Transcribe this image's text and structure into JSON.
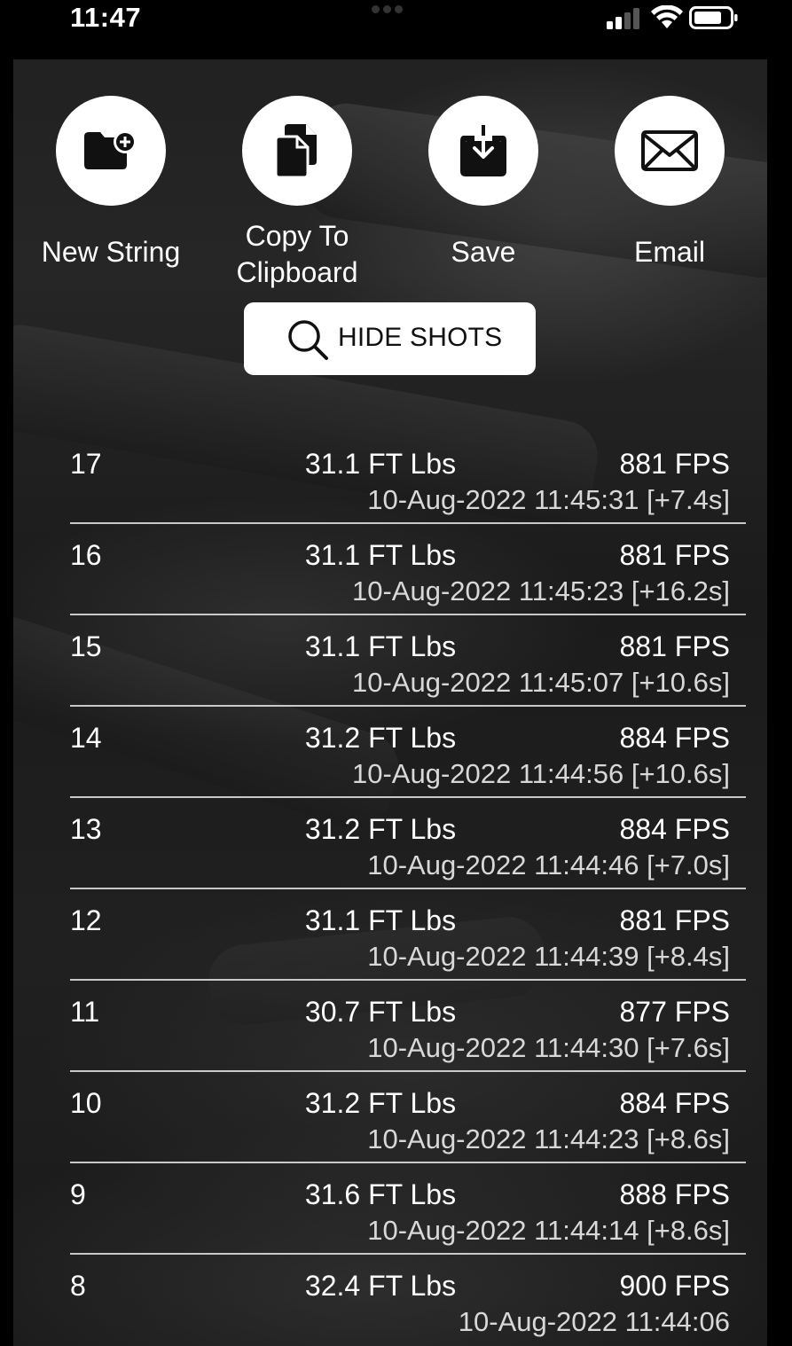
{
  "status_bar": {
    "time": "11:47"
  },
  "actions": [
    {
      "label": "New String",
      "icon": "folder-plus-icon"
    },
    {
      "label": "Copy To\nClipboard",
      "icon": "copy-documents-icon"
    },
    {
      "label": "Save",
      "icon": "download-icon"
    },
    {
      "label": "Email",
      "icon": "envelope-icon"
    }
  ],
  "hide_shots": {
    "label": "HIDE SHOTS",
    "icon": "search-icon"
  },
  "shots": [
    {
      "num": "17",
      "energy": "31.1 FT Lbs",
      "fps": "881 FPS",
      "time": "10-Aug-2022 11:45:31 [+7.4s]"
    },
    {
      "num": "16",
      "energy": "31.1 FT Lbs",
      "fps": "881 FPS",
      "time": "10-Aug-2022 11:45:23 [+16.2s]"
    },
    {
      "num": "15",
      "energy": "31.1 FT Lbs",
      "fps": "881 FPS",
      "time": "10-Aug-2022 11:45:07 [+10.6s]"
    },
    {
      "num": "14",
      "energy": "31.2 FT Lbs",
      "fps": "884 FPS",
      "time": "10-Aug-2022 11:44:56 [+10.6s]"
    },
    {
      "num": "13",
      "energy": "31.2 FT Lbs",
      "fps": "884 FPS",
      "time": "10-Aug-2022 11:44:46 [+7.0s]"
    },
    {
      "num": "12",
      "energy": "31.1 FT Lbs",
      "fps": "881 FPS",
      "time": "10-Aug-2022 11:44:39 [+8.4s]"
    },
    {
      "num": "11",
      "energy": "30.7 FT Lbs",
      "fps": "877 FPS",
      "time": "10-Aug-2022 11:44:30 [+7.6s]"
    },
    {
      "num": "10",
      "energy": "31.2 FT Lbs",
      "fps": "884 FPS",
      "time": "10-Aug-2022 11:44:23 [+8.6s]"
    },
    {
      "num": "9",
      "energy": "31.6 FT Lbs",
      "fps": "888 FPS",
      "time": "10-Aug-2022 11:44:14 [+8.6s]"
    },
    {
      "num": "8",
      "energy": "32.4 FT Lbs",
      "fps": "900 FPS",
      "time": "10-Aug-2022 11:44:06"
    }
  ]
}
